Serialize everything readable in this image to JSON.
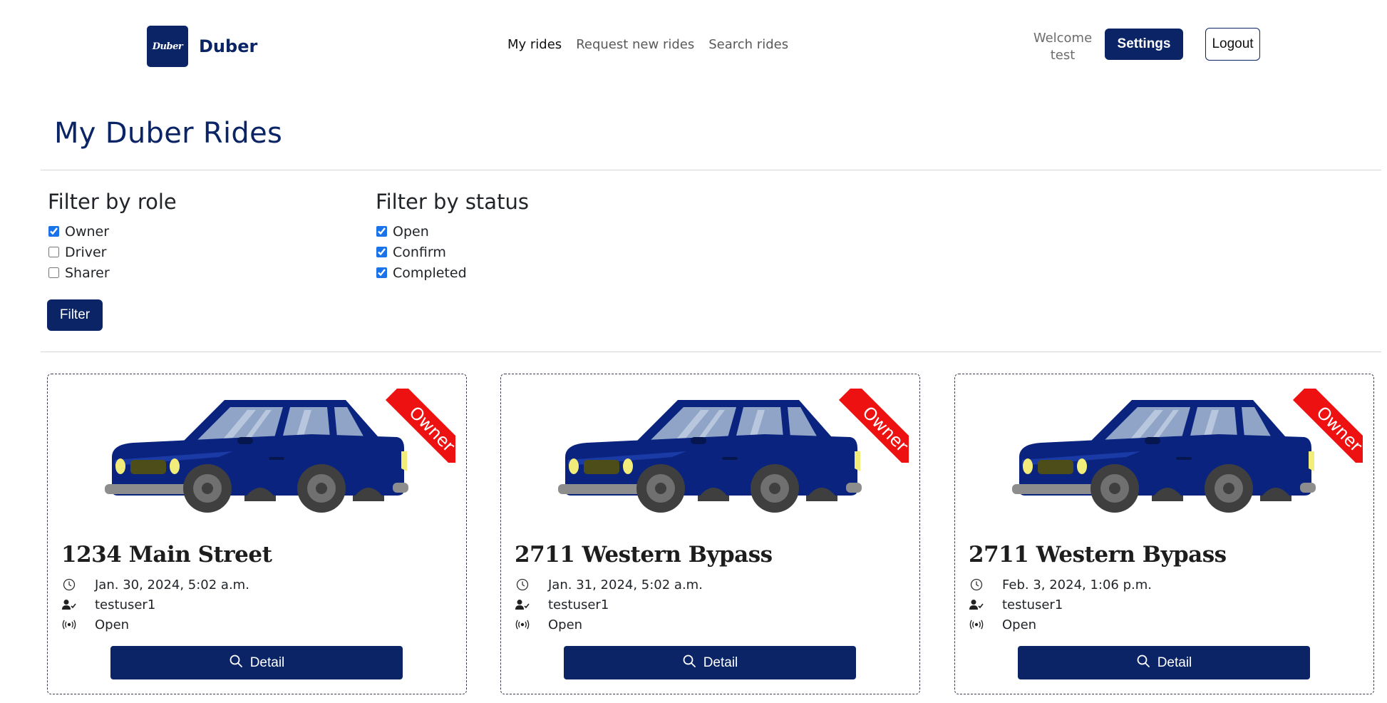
{
  "brand": {
    "logo_text": "Duber",
    "name": "Duber"
  },
  "nav": {
    "links": [
      "My rides",
      "Request new rides",
      "Search rides"
    ]
  },
  "user": {
    "welcome": "Welcome",
    "username": "test",
    "settings_label": "Settings",
    "logout_label": "Logout"
  },
  "page": {
    "title": "My Duber Rides"
  },
  "filters": {
    "role": {
      "heading": "Filter by role",
      "options": [
        {
          "label": "Owner",
          "checked": true
        },
        {
          "label": "Driver",
          "checked": false
        },
        {
          "label": "Sharer",
          "checked": false
        }
      ]
    },
    "status": {
      "heading": "Filter by status",
      "options": [
        {
          "label": "Open",
          "checked": true
        },
        {
          "label": "Confirm",
          "checked": true
        },
        {
          "label": "Completed",
          "checked": true
        }
      ]
    },
    "button_label": "Filter"
  },
  "rides": [
    {
      "destination": "1234 Main Street",
      "datetime": "Jan. 30, 2024, 5:02 a.m.",
      "owner": "testuser1",
      "status": "Open",
      "ribbon": "Owner",
      "detail_label": "Detail"
    },
    {
      "destination": "2711 Western Bypass",
      "datetime": "Jan. 31, 2024, 5:02 a.m.",
      "owner": "testuser1",
      "status": "Open",
      "ribbon": "Owner",
      "detail_label": "Detail"
    },
    {
      "destination": "2711 Western Bypass",
      "datetime": "Feb. 3, 2024, 1:06 p.m.",
      "owner": "testuser1",
      "status": "Open",
      "ribbon": "Owner",
      "detail_label": "Detail"
    }
  ],
  "colors": {
    "primary": "#0a2466",
    "ribbon": "#ee1111",
    "car_body": "#0a237f",
    "car_window": "#8fa4c6"
  },
  "icons": {
    "clock": "clock-icon",
    "user": "user-check-icon",
    "status": "broadcast-icon",
    "search": "search-icon"
  }
}
